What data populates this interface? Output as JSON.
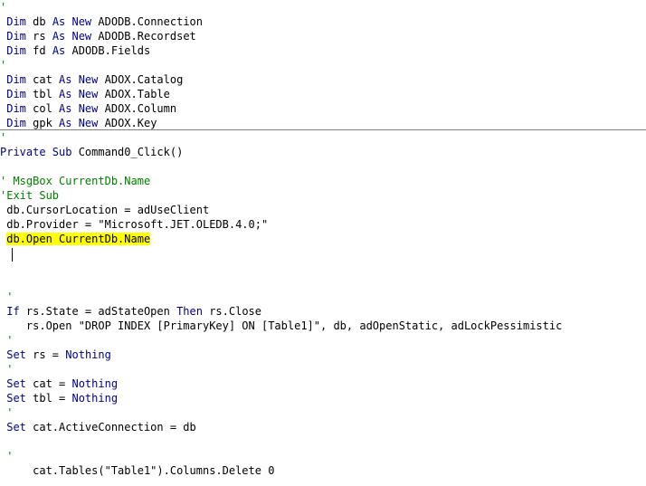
{
  "editor": {
    "colors": {
      "keyword": "#00008B",
      "comment": "#008000",
      "text": "#000000",
      "highlight": "#FFFF00",
      "separator": "#808080"
    },
    "declarations": [
      [
        {
          "t": "c",
          "v": "'"
        }
      ],
      [
        {
          "t": "k",
          "v": " Dim"
        },
        {
          "t": "p",
          "v": " db "
        },
        {
          "t": "k",
          "v": "As New"
        },
        {
          "t": "p",
          "v": " ADODB.Connection"
        }
      ],
      [
        {
          "t": "k",
          "v": " Dim"
        },
        {
          "t": "p",
          "v": " rs "
        },
        {
          "t": "k",
          "v": "As New"
        },
        {
          "t": "p",
          "v": " ADODB.Recordset"
        }
      ],
      [
        {
          "t": "k",
          "v": " Dim"
        },
        {
          "t": "p",
          "v": " fd "
        },
        {
          "t": "k",
          "v": "As"
        },
        {
          "t": "p",
          "v": " ADODB.Fields"
        }
      ],
      [
        {
          "t": "c",
          "v": "'"
        }
      ],
      [
        {
          "t": "k",
          "v": " Dim"
        },
        {
          "t": "p",
          "v": " cat "
        },
        {
          "t": "k",
          "v": "As New"
        },
        {
          "t": "p",
          "v": " ADOX.Catalog"
        }
      ],
      [
        {
          "t": "k",
          "v": " Dim"
        },
        {
          "t": "p",
          "v": " tbl "
        },
        {
          "t": "k",
          "v": "As New"
        },
        {
          "t": "p",
          "v": " ADOX.Table"
        }
      ],
      [
        {
          "t": "k",
          "v": " Dim"
        },
        {
          "t": "p",
          "v": " col "
        },
        {
          "t": "k",
          "v": "As New"
        },
        {
          "t": "p",
          "v": " ADOX.Column"
        }
      ],
      [
        {
          "t": "k",
          "v": " Dim"
        },
        {
          "t": "p",
          "v": " gpk "
        },
        {
          "t": "k",
          "v": "As New"
        },
        {
          "t": "p",
          "v": " ADOX.Key"
        }
      ]
    ],
    "procedure": [
      [
        {
          "t": "c",
          "v": "'"
        }
      ],
      [
        {
          "t": "k",
          "v": "Private Sub"
        },
        {
          "t": "p",
          "v": " Command0_Click()"
        }
      ],
      [],
      [
        {
          "t": "c",
          "v": "' MsgBox CurrentDb.Name"
        }
      ],
      [
        {
          "t": "c",
          "v": "'Exit Sub"
        }
      ],
      [
        {
          "t": "p",
          "v": " db.CursorLocation = adUseClient"
        }
      ],
      [
        {
          "t": "p",
          "v": " db.Provider = \"Microsoft.JET.OLEDB.4.0;\""
        }
      ],
      [
        {
          "t": "p",
          "v": " "
        },
        {
          "t": "h",
          "v": "db.Open CurrentDb.Name"
        }
      ],
      [],
      [],
      [],
      [
        {
          "t": "c",
          "v": " '"
        }
      ],
      [
        {
          "t": "k",
          "v": " If"
        },
        {
          "t": "p",
          "v": " rs.State = adStateOpen "
        },
        {
          "t": "k",
          "v": "Then"
        },
        {
          "t": "p",
          "v": " rs.Close"
        }
      ],
      [
        {
          "t": "p",
          "v": "    rs.Open \"DROP INDEX [PrimaryKey] ON [Table1]\", db, adOpenStatic, adLockPessimistic"
        }
      ],
      [
        {
          "t": "c",
          "v": " '"
        }
      ],
      [
        {
          "t": "k",
          "v": " Set"
        },
        {
          "t": "p",
          "v": " rs = "
        },
        {
          "t": "k",
          "v": "Nothing"
        }
      ],
      [
        {
          "t": "c",
          "v": " '"
        }
      ],
      [
        {
          "t": "k",
          "v": " Set"
        },
        {
          "t": "p",
          "v": " cat = "
        },
        {
          "t": "k",
          "v": "Nothing"
        }
      ],
      [
        {
          "t": "k",
          "v": " Set"
        },
        {
          "t": "p",
          "v": " tbl = "
        },
        {
          "t": "k",
          "v": "Nothing"
        }
      ],
      [
        {
          "t": "c",
          "v": " '"
        }
      ],
      [
        {
          "t": "k",
          "v": " Set"
        },
        {
          "t": "p",
          "v": " cat.ActiveConnection = db"
        }
      ],
      [],
      [
        {
          "t": "c",
          "v": " '"
        }
      ],
      [
        {
          "t": "p",
          "v": "     cat.Tables(\"Table1\").Columns.Delete 0"
        }
      ]
    ]
  }
}
